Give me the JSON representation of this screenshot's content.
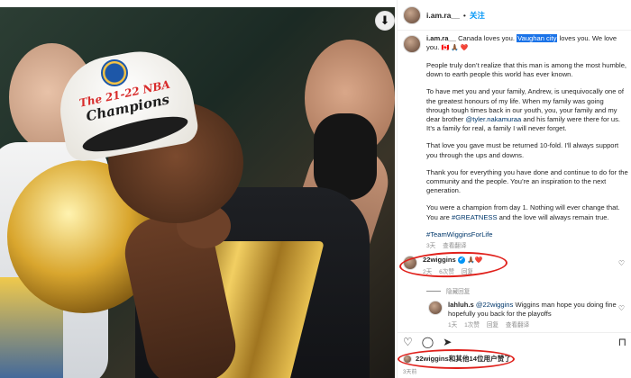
{
  "post": {
    "download_icon": "download-icon",
    "author": "i.am.ra__",
    "follow_label": "关注",
    "caption_first": "Canada loves you.",
    "caption_highlight": "Vaughan city",
    "caption_rest": "loves you. We love you.",
    "caption_emoji": "🇨🇦 🙏🏾 ❤️",
    "para1": "People truly don’t realize that this man is among the most humble, down to earth people this world has ever known.",
    "para2_a": "To have met you and your family, Andrew, is unequivocally one of the greatest honours of my life. When my family was going through tough times back in our youth, you, your family and my dear brother",
    "para2_mention": "@tyler.nakamuraa",
    "para2_b": "and his family were there for us. It’s a family for real, a family I will never forget.",
    "para3": "That love you gave must be returned 10-fold. I’ll always support you through the ups and downs.",
    "para4": "Thank you for everything you have done and continue to do for the community and the people. You’re an inspiration to the next generation.",
    "para5_a": "You were a champion from day 1. Nothing will ever change that. You are",
    "para5_tag": "#GREATNESS",
    "para5_b": "and the love will always remain true.",
    "hashtag": "#TeamWigginsForLife",
    "caption_time": "3天",
    "caption_translate": "查看翻译"
  },
  "comments": [
    {
      "user": "22wiggins",
      "verified": "✔",
      "text": "🙏🏾❤️",
      "time": "2天",
      "likes": "6次赞",
      "reply": "回复"
    },
    {
      "user": "lahluh.s",
      "mention": "@22wiggins",
      "text": "Wiggins man hope you doing fine hopefully you back for the playoffs",
      "time": "1天",
      "likes": "1次赞",
      "reply": "回复",
      "translate": "查看翻译"
    }
  ],
  "replies_toggle": "隐藏回复",
  "likes_summary": "22wiggins和其他14位用户赞了",
  "posted_ago": "3天前",
  "icons": {
    "like": "heart-icon",
    "comment": "comment-icon",
    "share": "share-icon",
    "save": "bookmark-icon"
  },
  "colors": {
    "link_blue": "#0095f6",
    "mention_blue": "#00376b",
    "annotation_red": "#e0201b",
    "highlight": "#1a73e8"
  }
}
